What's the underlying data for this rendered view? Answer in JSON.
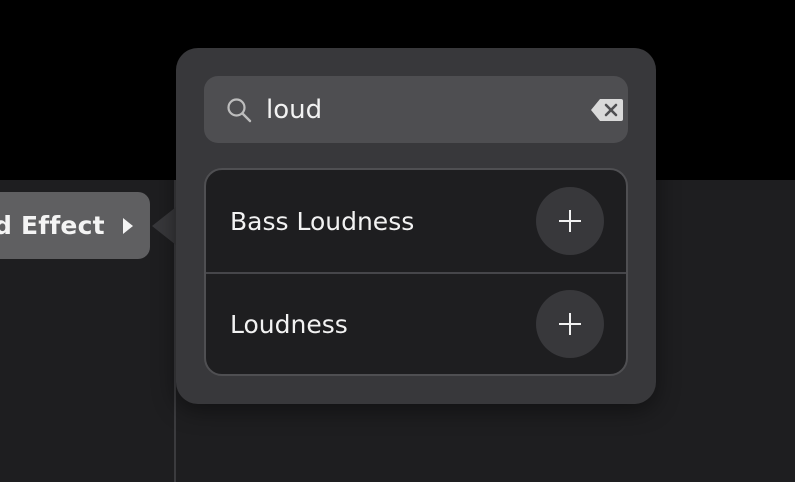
{
  "effect_button": {
    "label": "d Effect",
    "icon": "chevron-right-icon"
  },
  "search": {
    "value": "loud",
    "search_icon": "magnifier-icon",
    "clear_icon": "backspace-clear-icon"
  },
  "results": [
    {
      "label": "Bass Loudness",
      "action_icon": "plus-icon"
    },
    {
      "label": "Loudness",
      "action_icon": "plus-icon"
    }
  ],
  "colors": {
    "background": "#000000",
    "panel": "#1e1e20",
    "popover": "#38383b",
    "search_field": "#4e4e51",
    "effect_button": "#5f5f61",
    "text": "#f2f2f2"
  }
}
